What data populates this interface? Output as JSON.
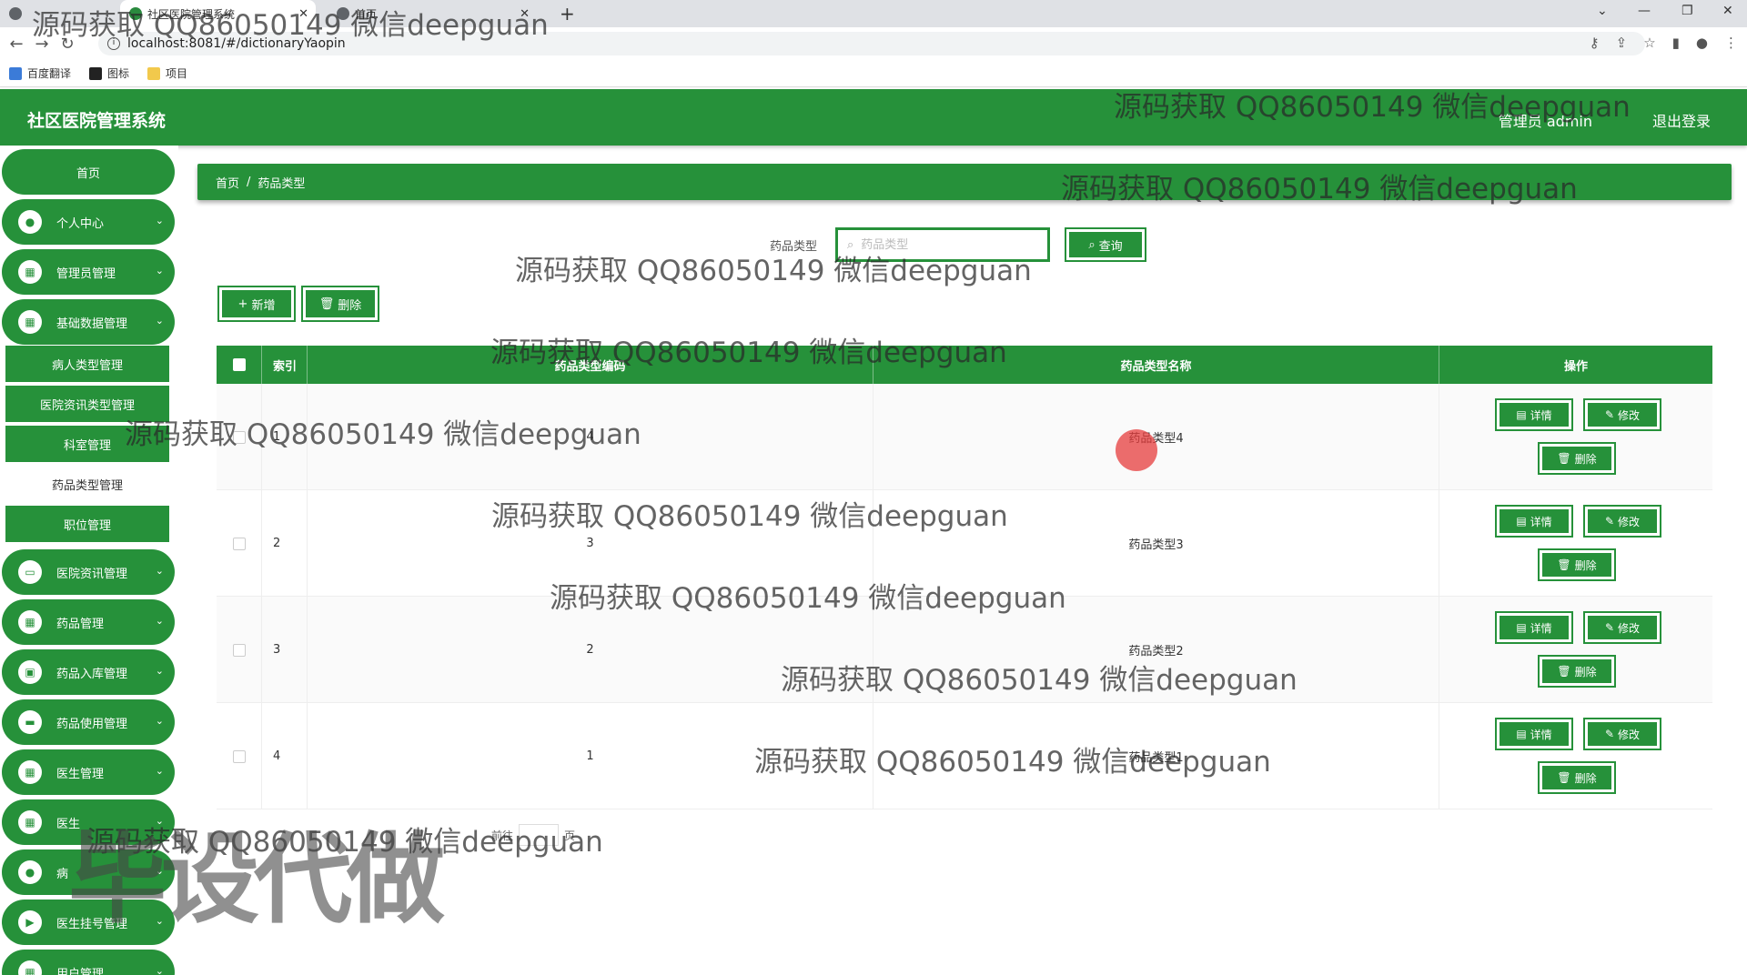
{
  "browser": {
    "tabs": [
      "社区医院管理系统",
      "",
      "首页"
    ],
    "url": "localhost:8081/#/dictionaryYaopin",
    "bookmarks": [
      "百度翻译",
      "图标",
      "项目"
    ]
  },
  "header": {
    "title": "社区医院管理系统",
    "admin": "管理员 admin",
    "logout": "退出登录"
  },
  "sidebar": {
    "home": "首页",
    "items": [
      "个人中心",
      "管理员管理",
      "基础数据管理",
      "医院资讯管理",
      "药品管理",
      "药品入库管理",
      "药品使用管理",
      "医生管理",
      "医生",
      "病",
      "医生挂号管理",
      "用户管理"
    ],
    "submenu": [
      "病人类型管理",
      "医院资讯类型管理",
      "科室管理",
      "药品类型管理",
      "职位管理"
    ],
    "active_submenu": "药品类型管理"
  },
  "breadcrumb": {
    "home": "首页",
    "current": "药品类型"
  },
  "search": {
    "label": "药品类型",
    "placeholder": "药品类型",
    "button": "查询"
  },
  "actions": {
    "add": "新增",
    "delete": "删除"
  },
  "table": {
    "headers": {
      "index": "索引",
      "code": "药品类型编码",
      "name": "药品类型名称",
      "ops": "操作"
    },
    "rows": [
      {
        "index": "1",
        "code": "4",
        "name": "药品类型4"
      },
      {
        "index": "2",
        "code": "3",
        "name": "药品类型3"
      },
      {
        "index": "3",
        "code": "2",
        "name": "药品类型2"
      },
      {
        "index": "4",
        "code": "1",
        "name": "药品类型1"
      }
    ],
    "op_labels": {
      "detail": "详情",
      "edit": "修改",
      "delete": "删除"
    }
  },
  "pager": {
    "prefix": "前往",
    "suffix": "页"
  },
  "watermarks": {
    "text": "源码获取 QQ86050149 微信deepguan",
    "big": "毕设代做"
  },
  "colors": {
    "primary": "#26913a"
  }
}
